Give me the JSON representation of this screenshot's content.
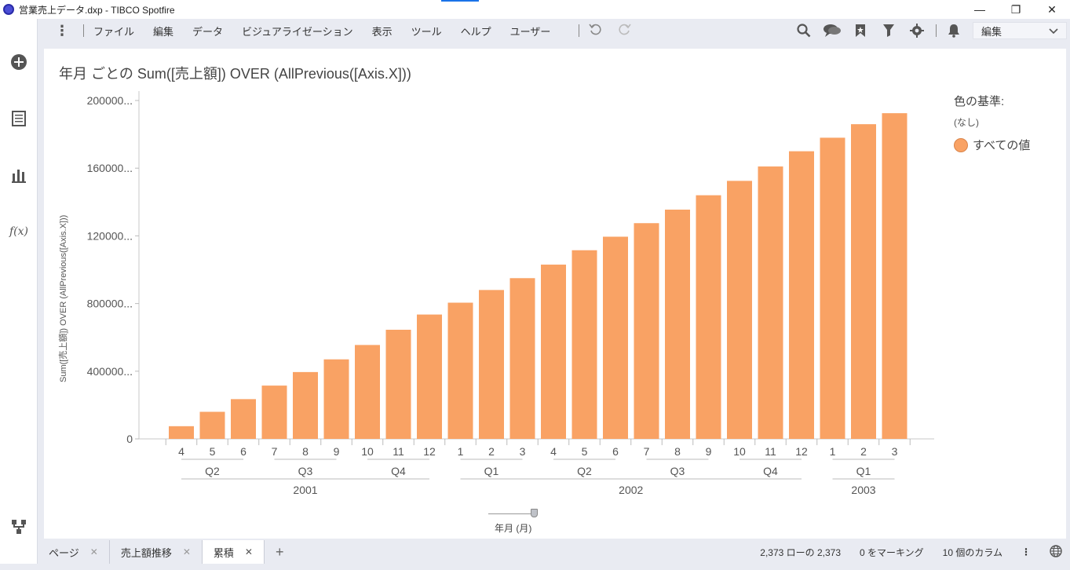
{
  "window": {
    "title": "営業売上データ.dxp - TIBCO Spotfire",
    "minimize": "—",
    "restore": "❐",
    "close": "✕"
  },
  "menu": {
    "items": [
      "ファイル",
      "編集",
      "データ",
      "ビジュアライゼーション",
      "表示",
      "ツール",
      "ヘルプ",
      "ユーザー"
    ],
    "undo_icon": "undo-icon",
    "redo_icon": "redo-icon",
    "edit_label": "編集"
  },
  "sidebar": {
    "icons": [
      "add-icon",
      "data-table-icon",
      "bar-chart-icon",
      "function-icon",
      "hierarchy-icon"
    ]
  },
  "visualization": {
    "title": "年月 ごとの Sum([売上額]) OVER (AllPrevious([Axis.X]))",
    "legend_title": "色の基準:",
    "legend_sub": "(なし)",
    "legend_item": "すべての値",
    "axis_control_label": "年月 (月)"
  },
  "chart_data": {
    "type": "bar",
    "title": "年月 ごとの Sum([売上額]) OVER (AllPrevious([Axis.X]))",
    "xlabel": "年月 (月)",
    "ylabel": "Sum([売上額]) OVER (AllPrevious([Axis.X]))",
    "y_tick_labels": [
      "0",
      "400000...",
      "800000...",
      "120000...",
      "160000...",
      "200000..."
    ],
    "y_ticks": [
      0,
      400000,
      800000,
      1200000,
      1600000,
      2000000
    ],
    "ylim": [
      0,
      2000000
    ],
    "grid": false,
    "legend_position": "right",
    "color": "#f9a264",
    "categories": [
      "4",
      "5",
      "6",
      "7",
      "8",
      "9",
      "10",
      "11",
      "12",
      "1",
      "2",
      "3",
      "4",
      "5",
      "6",
      "7",
      "8",
      "9",
      "10",
      "11",
      "12",
      "1",
      "2",
      "3"
    ],
    "quarters": [
      {
        "label": "Q2",
        "span": 3
      },
      {
        "label": "Q3",
        "span": 3
      },
      {
        "label": "Q4",
        "span": 3
      },
      {
        "label": "Q1",
        "span": 3
      },
      {
        "label": "Q2",
        "span": 3
      },
      {
        "label": "Q3",
        "span": 3
      },
      {
        "label": "Q4",
        "span": 3
      },
      {
        "label": "Q1",
        "span": 3
      }
    ],
    "years": [
      {
        "label": "2001",
        "span": 9
      },
      {
        "label": "2002",
        "span": 12
      },
      {
        "label": "2003",
        "span": 3
      }
    ],
    "series": [
      {
        "name": "すべての値",
        "values": [
          75000,
          160000,
          235000,
          315000,
          395000,
          470000,
          555000,
          645000,
          735000,
          805000,
          880000,
          950000,
          1030000,
          1115000,
          1195000,
          1275000,
          1355000,
          1440000,
          1525000,
          1610000,
          1700000,
          1780000,
          1860000,
          1925000
        ]
      }
    ]
  },
  "status": {
    "tabs": [
      "ページ",
      "売上額推移",
      "累積"
    ],
    "active_tab": "累積",
    "add_tab": "+",
    "rows": "2,373 ローの 2,373",
    "marked": "0 をマーキング",
    "columns": "10 個のカラム"
  }
}
